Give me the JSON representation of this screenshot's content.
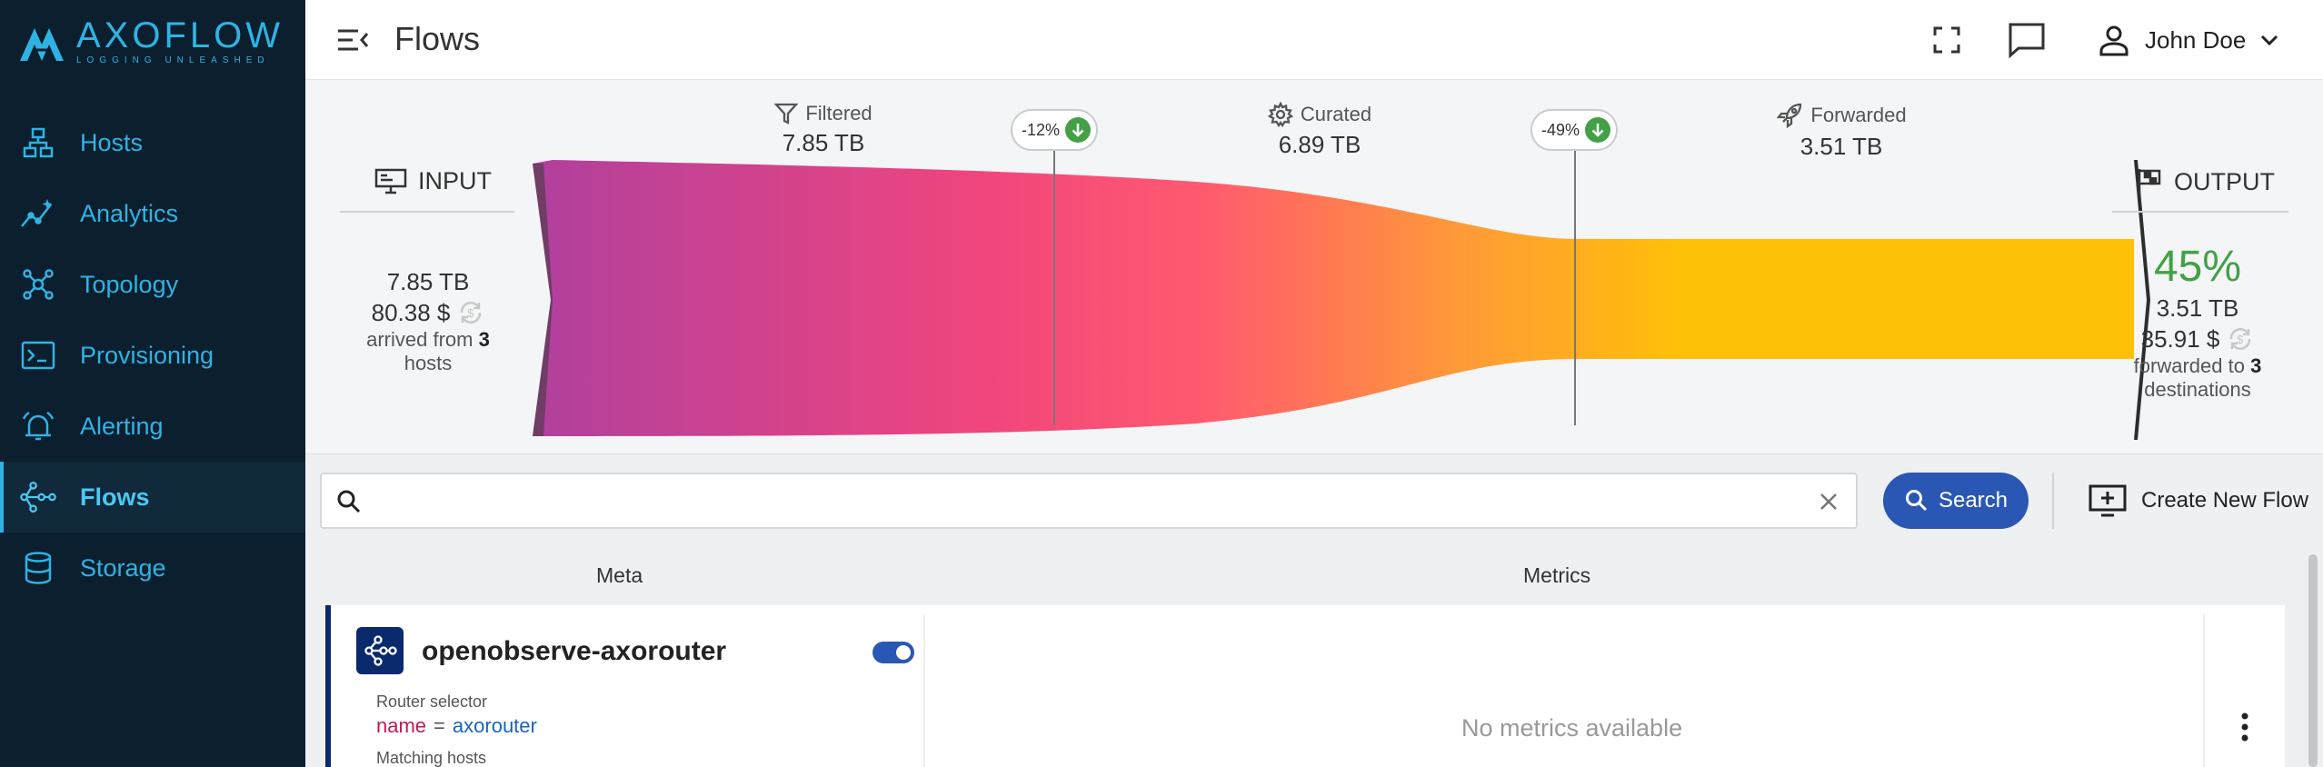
{
  "app": {
    "logo_name": "AXOFLOW",
    "logo_tagline": "LOGGING UNLEASHED",
    "brand_color": "#2fb3e5"
  },
  "sidebar": {
    "items": [
      {
        "label": "Hosts",
        "icon": "hosts-icon"
      },
      {
        "label": "Analytics",
        "icon": "analytics-icon"
      },
      {
        "label": "Topology",
        "icon": "topology-icon"
      },
      {
        "label": "Provisioning",
        "icon": "provisioning-icon"
      },
      {
        "label": "Alerting",
        "icon": "alerting-icon"
      },
      {
        "label": "Flows",
        "icon": "flows-icon",
        "active": true
      },
      {
        "label": "Storage",
        "icon": "storage-icon"
      }
    ]
  },
  "header": {
    "title": "Flows",
    "user_name": "John Doe"
  },
  "flow_summary": {
    "input": {
      "title": "INPUT",
      "volume": "7.85 TB",
      "cost": "80.38 $",
      "arrived_prefix": "arrived from",
      "host_count": "3",
      "arrived_suffix": "hosts"
    },
    "stages": [
      {
        "label": "Filtered",
        "value": "7.85 TB"
      },
      {
        "label": "Curated",
        "value": "6.89 TB"
      },
      {
        "label": "Forwarded",
        "value": "3.51 TB"
      }
    ],
    "reductions": [
      "-12%",
      "-49%"
    ],
    "output": {
      "title": "OUTPUT",
      "percent": "45%",
      "volume": "3.51 TB",
      "cost": "35.91 $",
      "forwarded_prefix": "forwarded to",
      "destination_count": "3",
      "forwarded_suffix": "destinations"
    },
    "colors": {
      "start": "#b0409d",
      "mid": "#ff5a6e",
      "end": "#ffc107",
      "positive": "#43a047"
    }
  },
  "search": {
    "value": "",
    "placeholder": "",
    "button_label": "Search",
    "create_label": "Create New Flow"
  },
  "table": {
    "columns": {
      "meta": "Meta",
      "metrics": "Metrics"
    },
    "flows": [
      {
        "name": "openobserve-axorouter",
        "enabled": true,
        "selector_label": "Router selector",
        "selector_key": "name",
        "selector_op": "=",
        "selector_value": "axorouter",
        "matching_label": "Matching hosts",
        "metrics_text": "No metrics available"
      }
    ]
  }
}
